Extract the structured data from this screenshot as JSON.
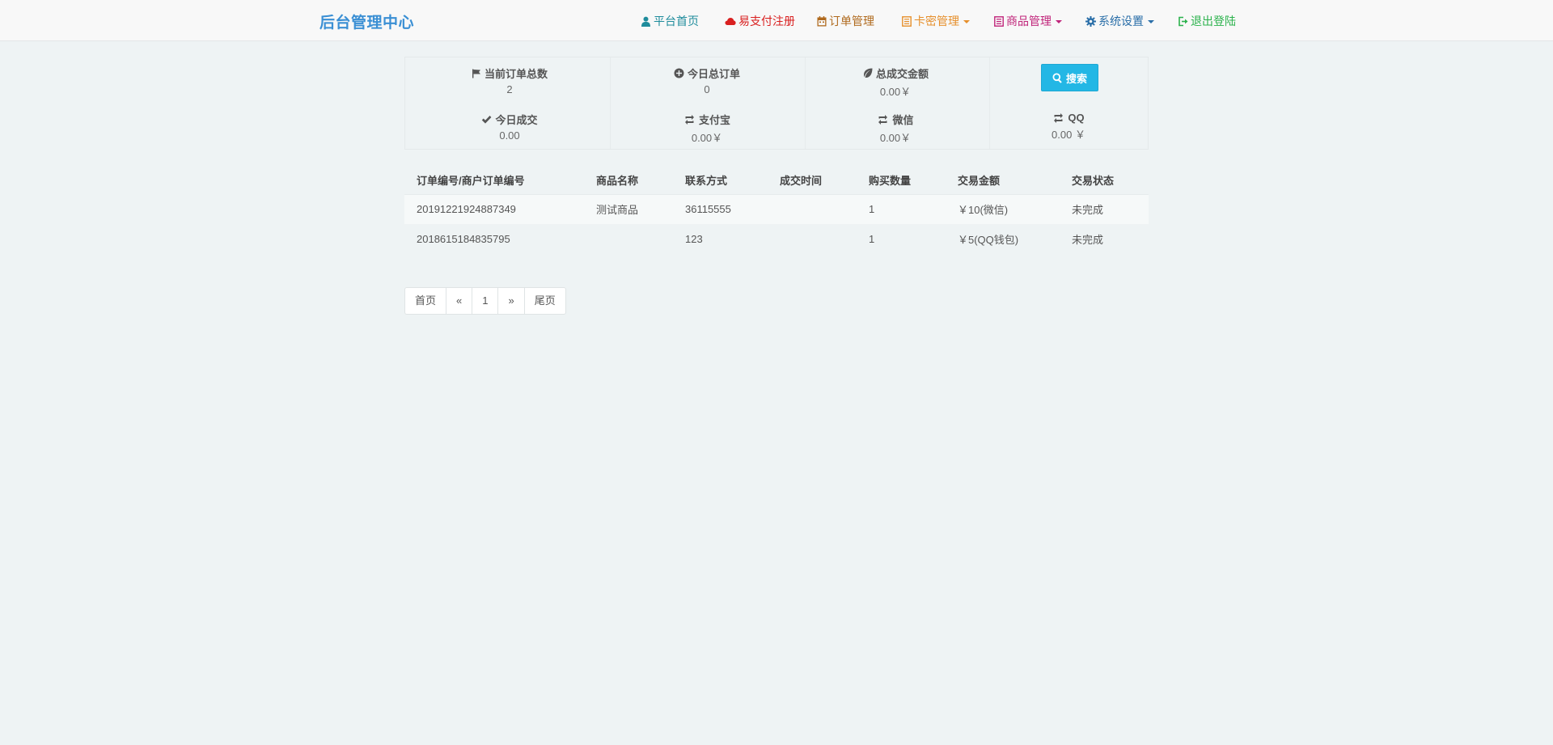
{
  "brand": "后台管理中心",
  "nav": {
    "home": "平台首页",
    "pay_register": "易支付注册",
    "orders": "订单管理",
    "cards": "卡密管理",
    "goods": "商品管理",
    "settings": "系统设置",
    "logout": "退出登陆"
  },
  "colors": {
    "home": "#1f8c9c",
    "pay_register": "#d92020",
    "orders": "#b06a1e",
    "cards": "#e68f2c",
    "goods": "#c0247a",
    "settings": "#2a6ea8",
    "logout": "#2bb24c",
    "search_button": "#23b7e5"
  },
  "stats": {
    "total_orders": {
      "label": "当前订单总数",
      "value": "2"
    },
    "today_orders": {
      "label": "今日总订单",
      "value": "0"
    },
    "total_amount": {
      "label": "总成交金额",
      "value": "0.00￥"
    },
    "today_deal": {
      "label": "今日成交",
      "value": "0.00"
    },
    "alipay": {
      "label": "支付宝",
      "value": "0.00￥"
    },
    "wechat": {
      "label": "微信",
      "value": "0.00￥"
    },
    "qq": {
      "label": "QQ",
      "value": "0.00 ￥"
    },
    "search_label": "搜索"
  },
  "table": {
    "headers": {
      "order_no": "订单编号/商户订单编号",
      "product": "商品名称",
      "contact": "联系方式",
      "deal_time": "成交时间",
      "quantity": "购买数量",
      "amount": "交易金额",
      "status": "交易状态"
    },
    "rows": [
      {
        "order_no": "20191221924887349",
        "product": "测试商品",
        "contact": "36115555",
        "deal_time": "",
        "quantity": "1",
        "amount": "￥10(微信)",
        "status": "未完成"
      },
      {
        "order_no": "2018615184835795",
        "product": "",
        "contact": "123",
        "deal_time": "",
        "quantity": "1",
        "amount": "￥5(QQ钱包)",
        "status": "未完成"
      }
    ]
  },
  "pager": {
    "first": "首页",
    "prev": "«",
    "page1": "1",
    "next": "»",
    "last": "尾页"
  }
}
